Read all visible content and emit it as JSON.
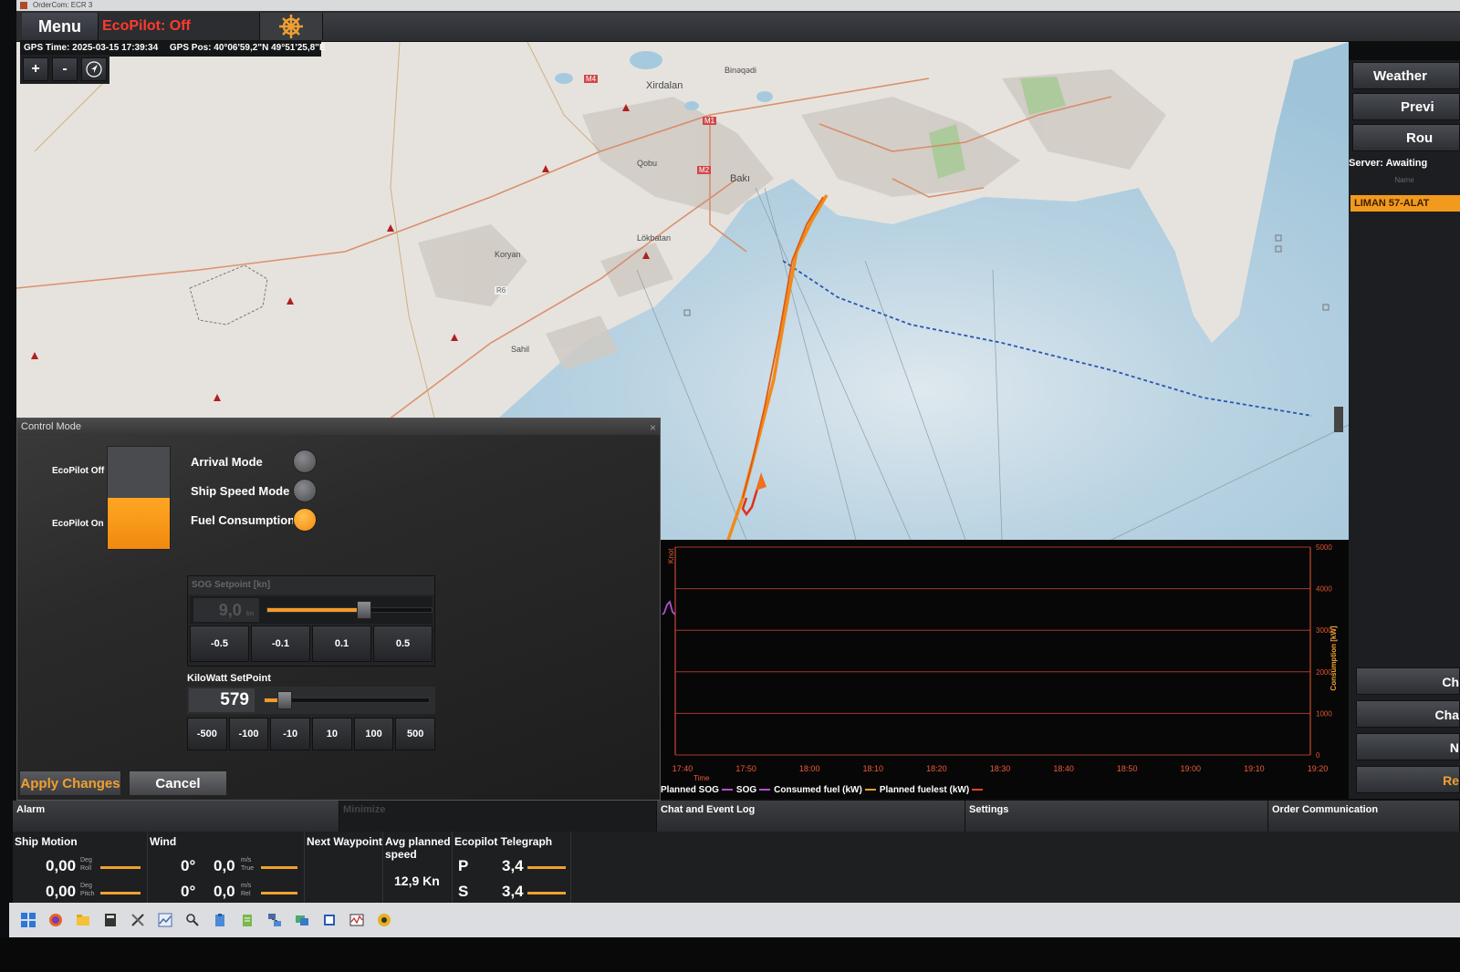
{
  "window": {
    "title": "OrderCom: ECR 3"
  },
  "topbar": {
    "menu_label": "Menu",
    "ecopilot_status": "EcoPilot: Off"
  },
  "gps": {
    "time": "GPS Time: 2025-03-15 17:39:34",
    "position": "GPS Pos: 40°06'59,2\"N 49°51'25,8\"E"
  },
  "map": {
    "controls": {
      "zoom_in": "+",
      "zoom_out": "-"
    },
    "labels": {
      "xirdalan": "Xirdalan",
      "baki": "Bakı",
      "lokbatan": "Lökbatan",
      "qobu": "Qobu",
      "binagadi": "Binəqədi",
      "sahil": "Sahil",
      "koryan": "Koryan",
      "m1": "M1",
      "m2": "M2",
      "m4": "M4",
      "r6": "R6"
    }
  },
  "right_panel": {
    "weather": "Weather",
    "preview": "Previ",
    "route": "Rou",
    "server_status": "Server: Awaiting",
    "name_header": "Name",
    "route_item": "LIMAN 57-ALAT",
    "lower_buttons": [
      "Ch",
      "Cha",
      "N",
      "Re"
    ]
  },
  "control_dialog": {
    "title": "Control Mode",
    "ecopilot_off_label": "EcoPilot Off",
    "ecopilot_on_label": "EcoPilot On",
    "modes": [
      {
        "label": "Arrival Mode",
        "selected": false
      },
      {
        "label": "Ship Speed Mode",
        "selected": false
      },
      {
        "label": "Fuel Consumption",
        "selected": true
      }
    ],
    "sog": {
      "header": "SOG Setpoint [kn]",
      "value": "9,0",
      "unit": "kn",
      "slider_fraction": 0.58,
      "steps": [
        "-0.5",
        "-0.1",
        "0.1",
        "0.5"
      ]
    },
    "kw": {
      "header": "KiloWatt SetPoint",
      "value": "579",
      "slider_fraction": 0.12,
      "steps": [
        "-500",
        "-100",
        "-10",
        "10",
        "100",
        "500"
      ]
    },
    "apply_label": "Apply Changes",
    "cancel_label": "Cancel"
  },
  "chart_data": {
    "type": "line",
    "x_ticks": [
      "17:40",
      "17:50",
      "18:00",
      "18:10",
      "18:20",
      "18:30",
      "18:40",
      "18:50",
      "19:00",
      "19:10",
      "19:20"
    ],
    "xlabel": "Time",
    "y_left_label": "Knot",
    "y_right_label": "Consumption [kW]",
    "y_right_ticks": [
      "0",
      "1000",
      "2000",
      "3000",
      "4000",
      "5000"
    ],
    "ylim_right": [
      0,
      5000
    ],
    "series": [
      {
        "name": "Planned SOG",
        "color": "#b44fd0",
        "points": []
      },
      {
        "name": "SOG",
        "color": "#b44fd0",
        "points": [
          [
            0,
            0.45
          ],
          [
            0.1,
            0.5
          ],
          [
            0.25,
            0.72
          ],
          [
            0.4,
            0.8
          ],
          [
            0.55,
            0.52
          ],
          [
            0.7,
            0.45
          ]
        ]
      },
      {
        "name": "Consumed fuel (kW)",
        "color": "#f0a030",
        "points": []
      },
      {
        "name": "Planned fuelest (kW)",
        "color": "#e84030",
        "points": []
      }
    ],
    "grid": true,
    "legend_position": "bottom-left"
  },
  "tabs": {
    "alarm": "Alarm",
    "minimize": "Minimize",
    "chat_event_log": "Chat and Event Log",
    "settings": "Settings",
    "order_communication": "Order Communication"
  },
  "status": {
    "ship_motion": {
      "title": "Ship Motion",
      "roll": "0,00",
      "pitch": "0,00",
      "unit": "Deg",
      "roll_label": "Roll",
      "pitch_label": "Pitch"
    },
    "wind": {
      "title": "Wind",
      "dir_true": "0°",
      "speed_true": "0,0",
      "dir_rel": "0°",
      "speed_rel": "0,0",
      "unit": "m/s",
      "true_label": "True",
      "rel_label": "Rel"
    },
    "next_waypoint": {
      "title": "Next Waypoint"
    },
    "avg_speed": {
      "title": "Avg planned speed",
      "value": "12,9 Kn"
    },
    "telegraph": {
      "title": "Ecopilot Telegraph",
      "p_label": "P",
      "p_value": "3,4",
      "s_label": "S",
      "s_value": "3,4"
    }
  },
  "colors": {
    "accent": "#f39a1e",
    "alert": "#ff3a2e",
    "map_sea": "#a9cbe0",
    "map_land": "#e4e1dc"
  }
}
